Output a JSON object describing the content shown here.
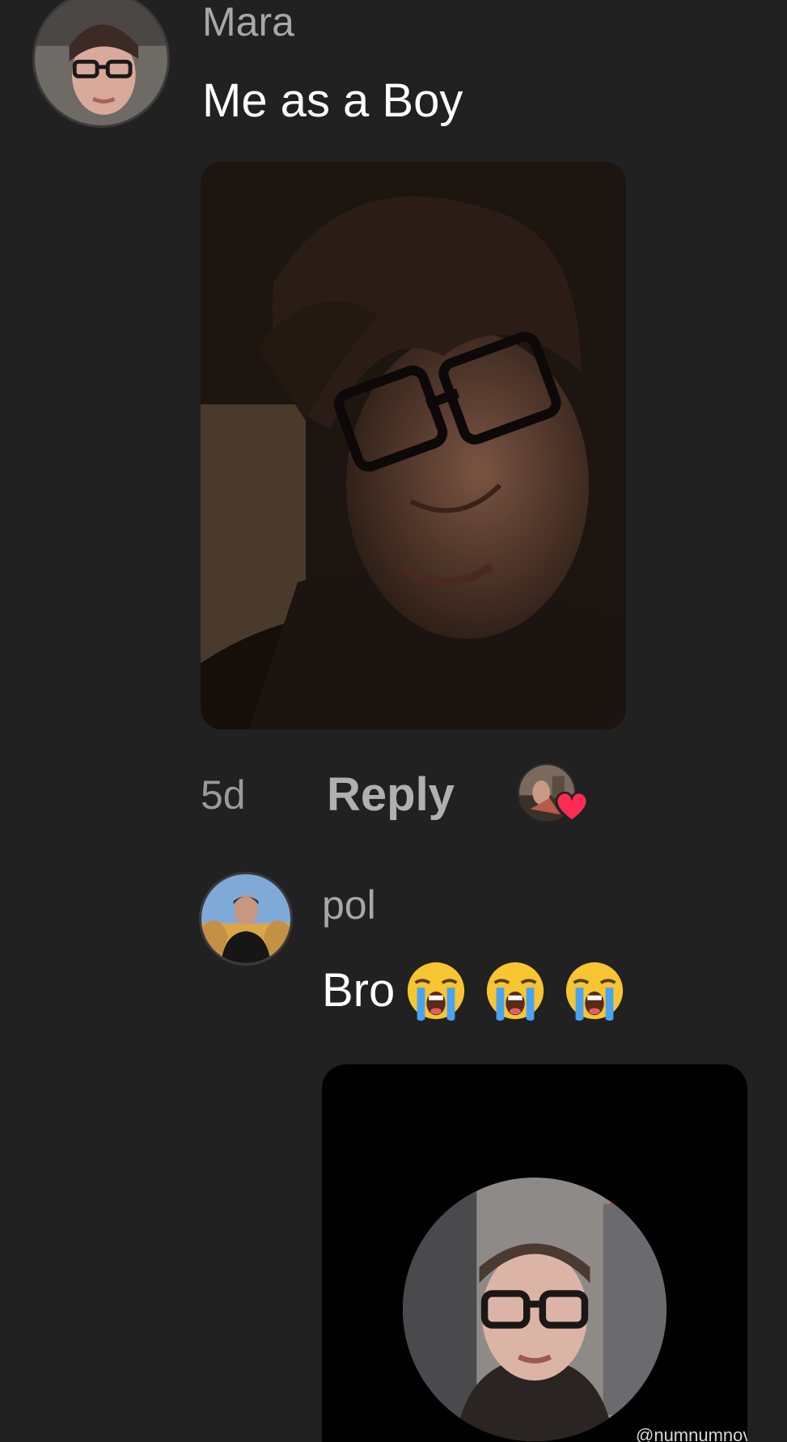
{
  "comment": {
    "username": "Mara",
    "text": "Me as a Boy",
    "time": "5d",
    "reply_label": "Reply",
    "avatar_icon": "user-avatar",
    "liked_by_icon": "creator-avatar-heart"
  },
  "reply": {
    "username": "pol",
    "text": "Bro",
    "emojis": [
      "loudly-crying-face",
      "loudly-crying-face",
      "loudly-crying-face"
    ],
    "avatar_icon": "user-avatar"
  },
  "video": {
    "watermark": "@numnumnov"
  },
  "colors": {
    "background": "#212121",
    "username": "#a8a8a8",
    "text": "#ffffff",
    "meta": "#9a9a9a",
    "heart": "#fe2c55"
  }
}
